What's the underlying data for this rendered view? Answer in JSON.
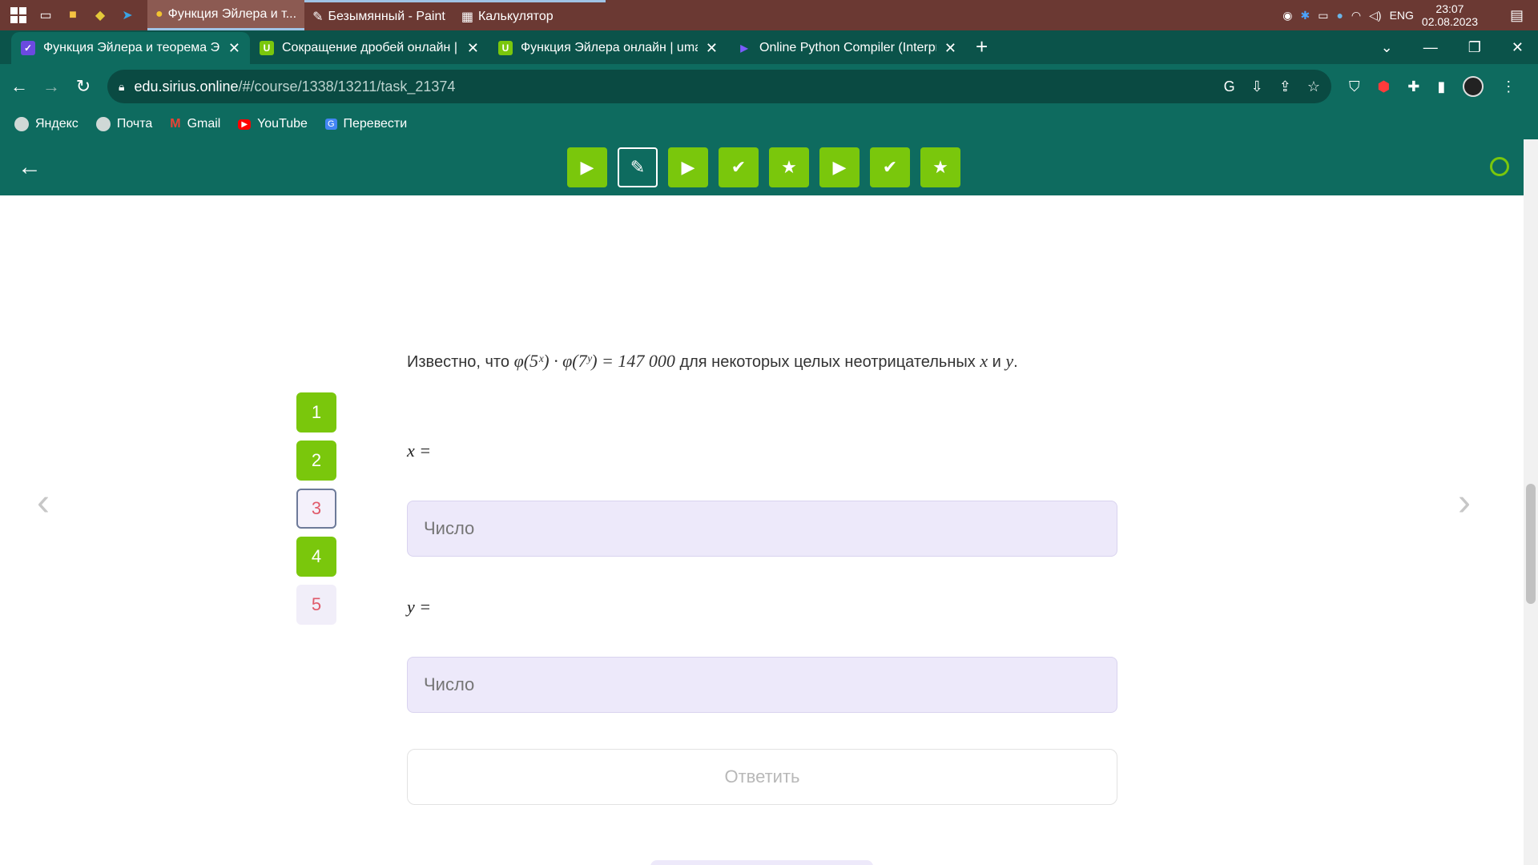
{
  "taskbar": {
    "apps": [
      {
        "label": "Функция Эйлера и т...",
        "state": "active"
      },
      {
        "label": "Безымянный - Paint",
        "state": "open"
      },
      {
        "label": "Калькулятор",
        "state": "open"
      }
    ],
    "lang": "ENG",
    "time": "23:07",
    "date": "02.08.2023"
  },
  "tabs": [
    {
      "title": "Функция Эйлера и теорема Эйл",
      "favicon": "sirius-icon",
      "active": true
    },
    {
      "title": "Сокращение дробей онлайн | u",
      "favicon": "umath-icon",
      "active": false
    },
    {
      "title": "Функция Эйлера онлайн | umatl",
      "favicon": "umath-icon",
      "active": false
    },
    {
      "title": "Online Python Compiler (Interpre",
      "favicon": "python-compiler-icon",
      "active": false
    }
  ],
  "address": {
    "domain": "edu.sirius.online",
    "path": "/#/course/1338/13211/task_21374"
  },
  "bookmarks": [
    "Яндекс",
    "Почта",
    "Gmail",
    "YouTube",
    "Перевести"
  ],
  "progress_steps": [
    "play",
    "edit",
    "play",
    "check",
    "star",
    "play",
    "check",
    "star"
  ],
  "task": {
    "intro": "Известно, что",
    "formula": "φ(5ˣ) · φ(7ʸ) = 147 000",
    "tail": "для некоторых целых неотрицательных",
    "var_x": "x",
    "conj": "и",
    "var_y": "y",
    "period": "."
  },
  "task_numbers": [
    {
      "n": "1",
      "state": "done"
    },
    {
      "n": "2",
      "state": "done"
    },
    {
      "n": "3",
      "state": "active"
    },
    {
      "n": "4",
      "state": "done"
    },
    {
      "n": "5",
      "state": "idle"
    }
  ],
  "answers": {
    "x_label": "x =",
    "y_label": "y =",
    "placeholder": "Число",
    "submit_label": "Ответить"
  },
  "colors": {
    "accent": "#7ac70c",
    "header": "#0e6b5f",
    "field": "#ede9fa"
  }
}
